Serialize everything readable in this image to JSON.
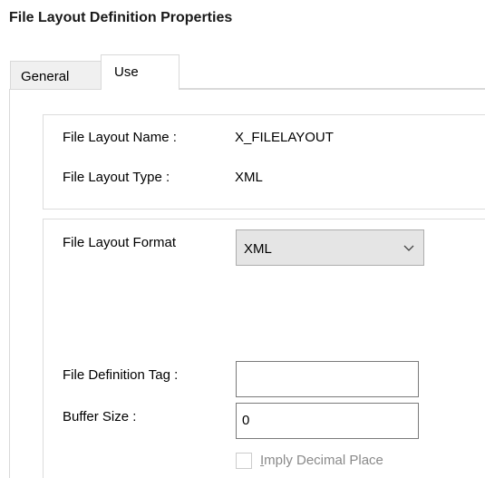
{
  "window": {
    "title": "File Layout Definition Properties"
  },
  "tabs": [
    {
      "label": "General",
      "selected": false
    },
    {
      "label": "Use",
      "selected": true
    }
  ],
  "info": {
    "name_label": "File Layout Name :",
    "name_value": "X_FILELAYOUT",
    "type_label": "File Layout Type :",
    "type_value": "XML"
  },
  "format": {
    "label": "File Layout Format",
    "selected": "XML"
  },
  "definition_tag": {
    "label": "File Definition Tag :",
    "value": ""
  },
  "buffer_size": {
    "label": "Buffer Size :",
    "value": "0"
  },
  "imply_decimal": {
    "mnemonic": "I",
    "rest": "mply Decimal Place",
    "checked": false,
    "enabled": false
  },
  "colors": {
    "border": "#d9d9d9",
    "combo_bg": "#e5e5e5",
    "disabled_text": "#8a8a8a"
  }
}
